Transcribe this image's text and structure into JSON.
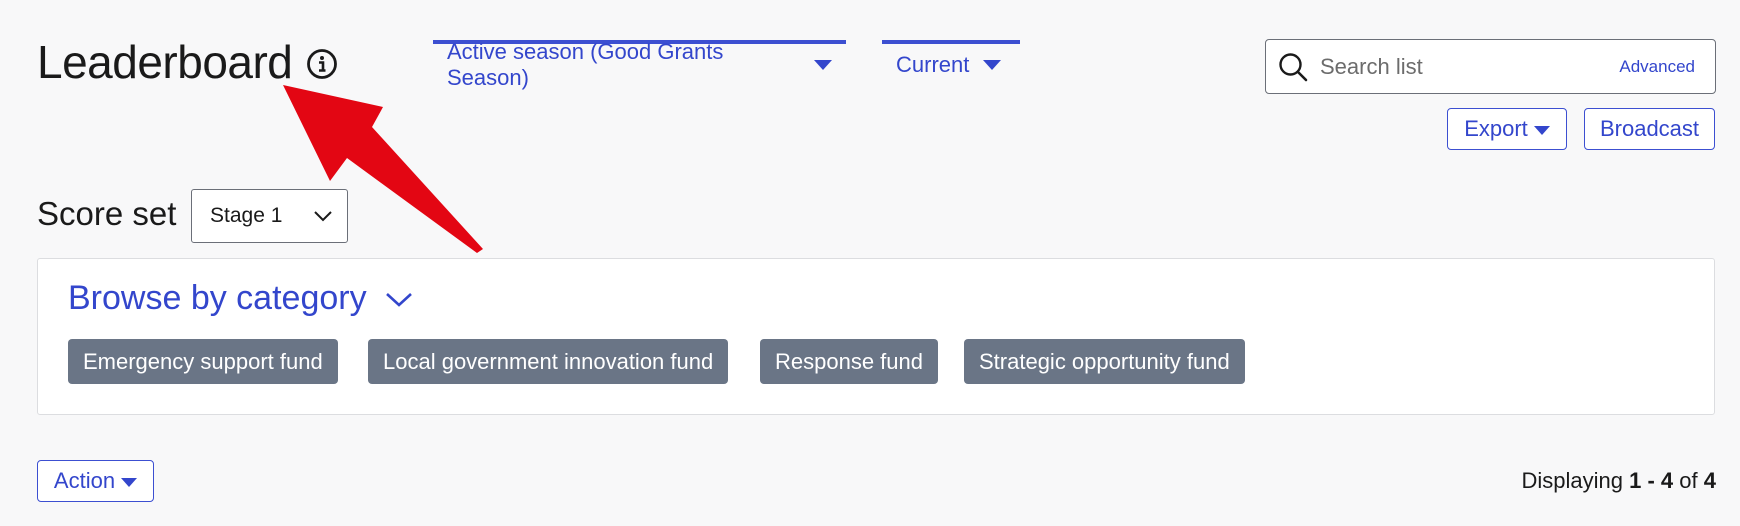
{
  "header": {
    "title": "Leaderboard",
    "info_icon": "info-circle-icon"
  },
  "filters": {
    "season_label": "Active season (Good Grants Season)",
    "status_label": "Current",
    "accent_color": "#3c4fd1"
  },
  "search": {
    "placeholder": "Search list",
    "value": "",
    "advanced_label": "Advanced"
  },
  "toolbar": {
    "export_label": "Export",
    "broadcast_label": "Broadcast"
  },
  "score_set": {
    "label": "Score set",
    "selected": "Stage 1"
  },
  "browse": {
    "title": "Browse by category",
    "categories": [
      "Emergency support fund",
      "Local government innovation fund",
      "Response fund",
      "Strategic opportunity fund"
    ],
    "tag_color": "#6a7586"
  },
  "footer": {
    "action_label": "Action",
    "displaying_prefix": "Displaying",
    "range": "1 - 4",
    "of_label": "of",
    "total": "4"
  },
  "annotation": {
    "arrow_color": "#e30613"
  }
}
